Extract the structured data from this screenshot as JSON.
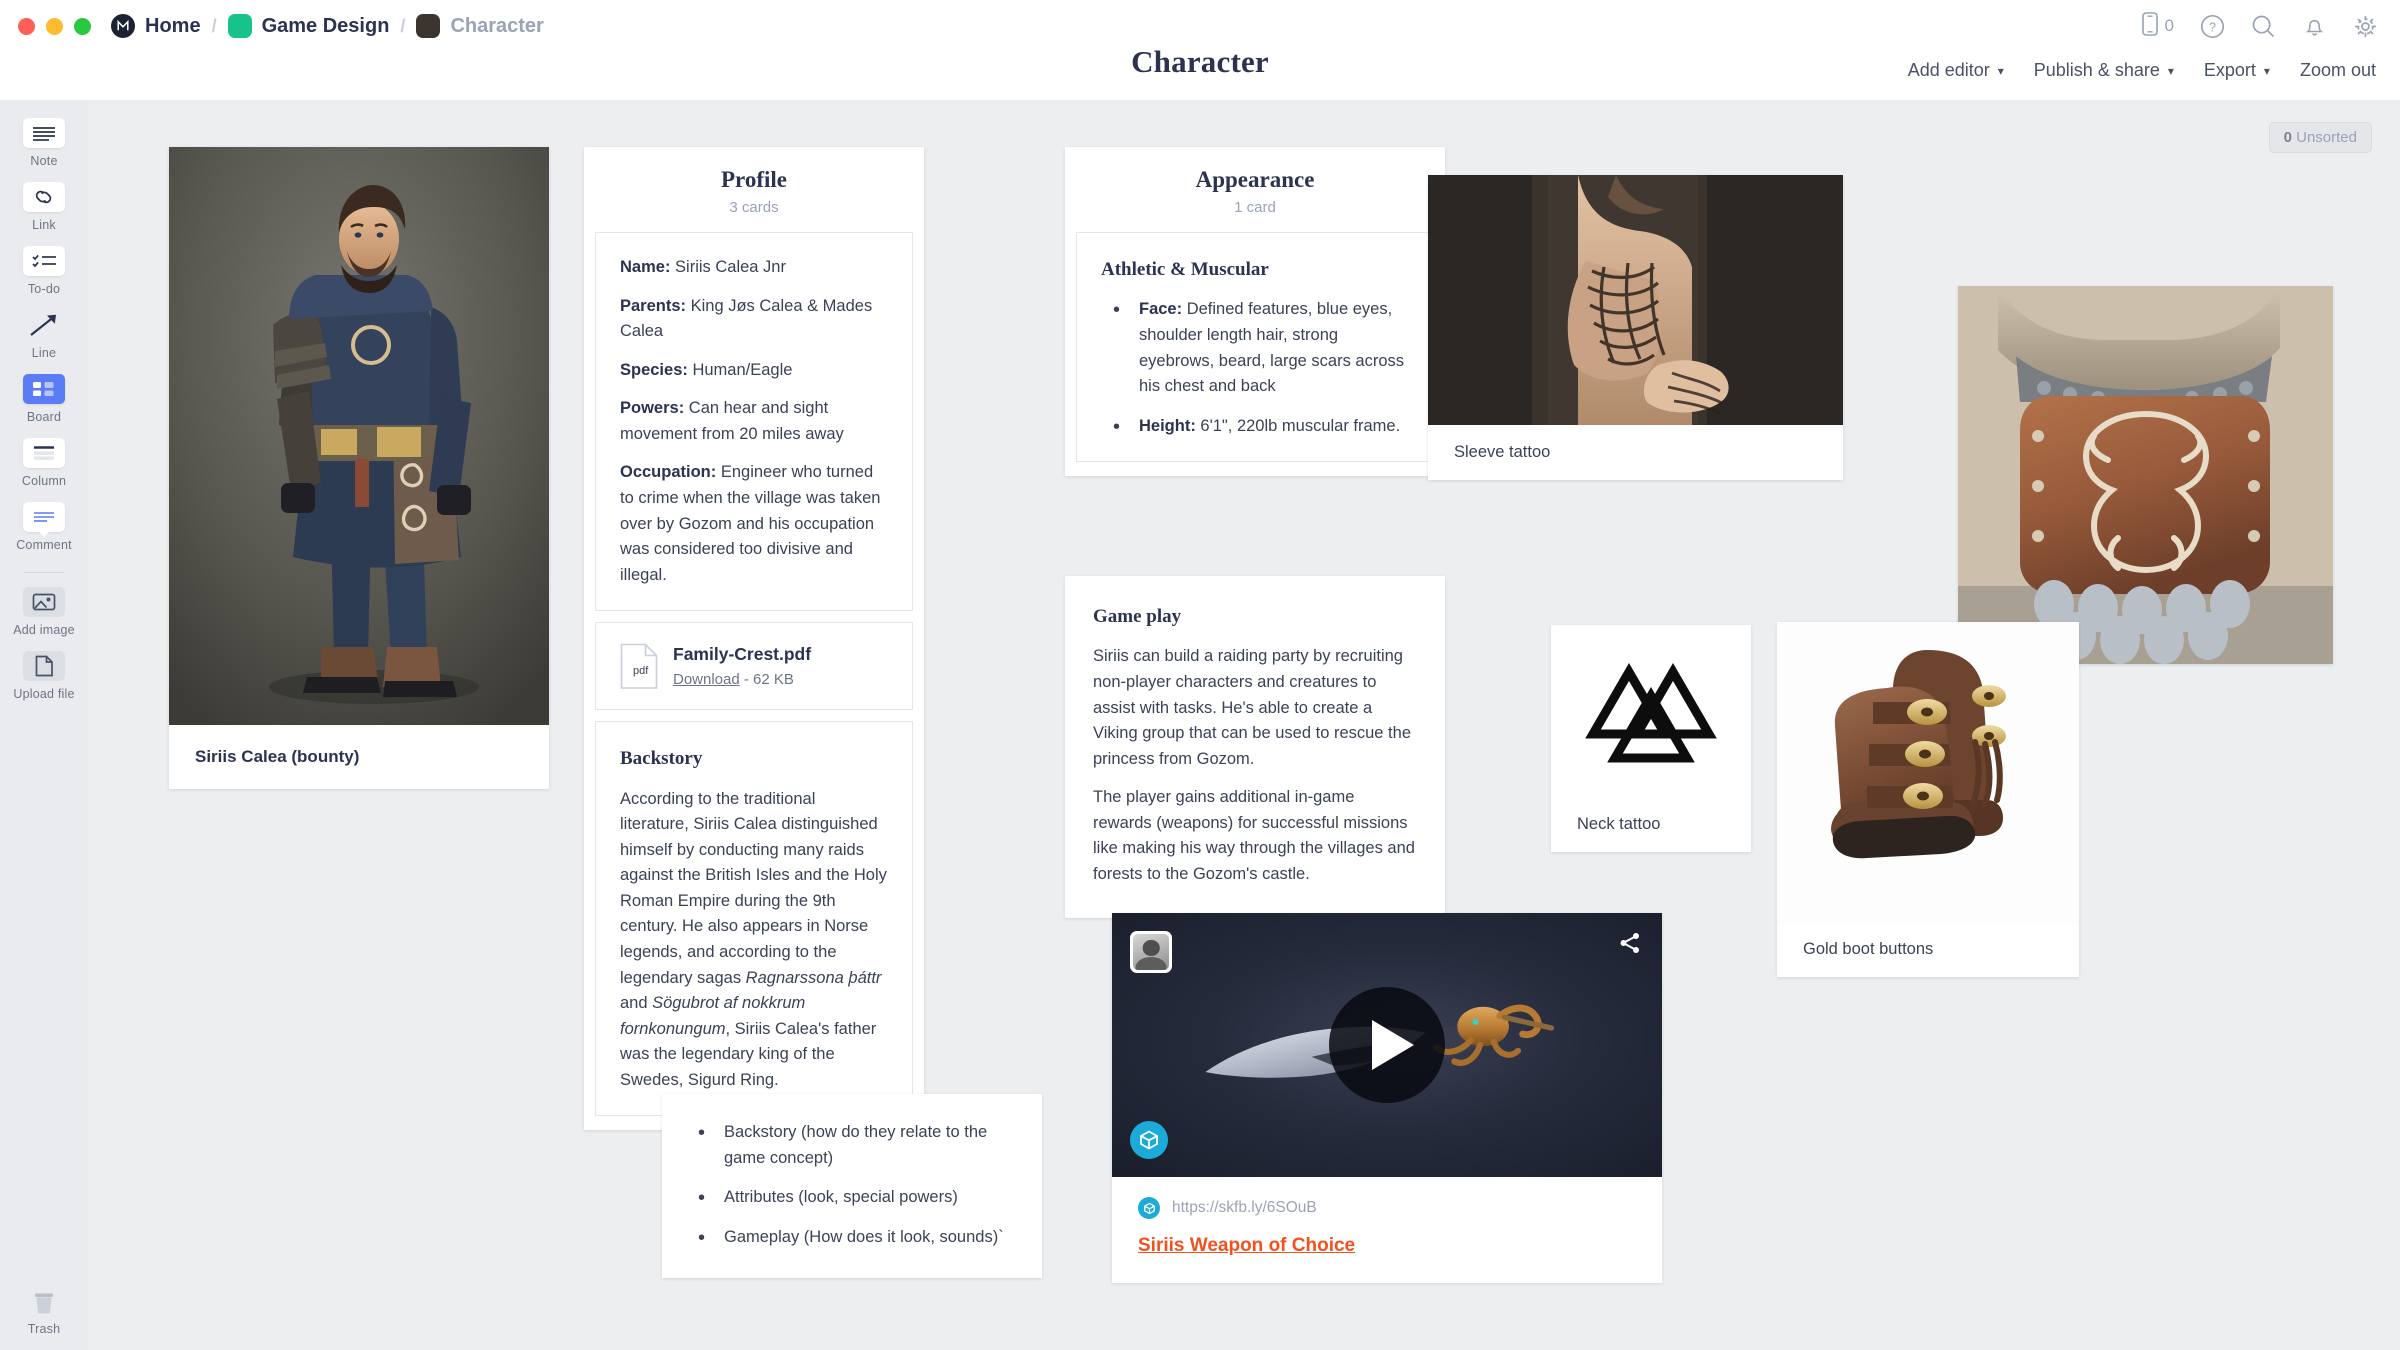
{
  "window": {
    "traffic_lights": [
      "close",
      "minimize",
      "zoom"
    ],
    "breadcrumbs": [
      {
        "label": "Home",
        "icon": "milanote-logo-icon",
        "color": "#1d2233"
      },
      {
        "label": "Game Design",
        "icon": "board-swatch-icon",
        "color": "#17c38a"
      },
      {
        "label": "Character",
        "icon": "board-swatch-icon",
        "color": "#3c352f"
      }
    ],
    "device_count": "0",
    "icons": [
      "mobile-preview-icon",
      "help-icon",
      "search-icon",
      "notifications-icon",
      "settings-gear-icon"
    ]
  },
  "header": {
    "title": "Character",
    "actions": [
      {
        "label": "Add editor",
        "has_caret": true
      },
      {
        "label": "Publish & share",
        "has_caret": true
      },
      {
        "label": "Export",
        "has_caret": true
      },
      {
        "label": "Zoom out",
        "has_caret": false
      }
    ]
  },
  "toolbar": {
    "items": [
      {
        "label": "Note",
        "icon": "note-icon",
        "active": false
      },
      {
        "label": "Link",
        "icon": "link-icon",
        "active": false
      },
      {
        "label": "To-do",
        "icon": "todo-icon",
        "active": false
      },
      {
        "label": "Line",
        "icon": "line-arrow-icon",
        "active": false
      },
      {
        "label": "Board",
        "icon": "board-icon",
        "active": true
      },
      {
        "label": "Column",
        "icon": "column-icon",
        "active": false
      },
      {
        "label": "Comment",
        "icon": "comment-icon",
        "active": false
      },
      {
        "label": "Add image",
        "icon": "image-icon",
        "active": false
      },
      {
        "label": "Upload file",
        "icon": "file-icon",
        "active": false
      }
    ],
    "trash": {
      "label": "Trash",
      "icon": "trash-icon"
    },
    "accent_color": "#5b7cf5"
  },
  "canvas": {
    "unsorted_badge": {
      "count": "0",
      "label": "Unsorted"
    },
    "hero": {
      "caption": "Siriis Calea (bounty)",
      "image_alt": "character-concept-art"
    },
    "profile_column": {
      "title": "Profile",
      "card_count": "3 cards",
      "details": [
        {
          "label": "Name:",
          "value": " Siriis Calea Jnr"
        },
        {
          "label": "Parents:",
          "value": " King Jøs Calea & Mades Calea"
        },
        {
          "label": "Species:",
          "value": " Human/Eagle"
        },
        {
          "label": "Powers:",
          "value": " Can hear and sight movement from 20 miles away"
        },
        {
          "label": "Occupation:",
          "value": " Engineer who turned to crime when the village was taken over by Gozom and his occupation was considered too divisive and illegal."
        }
      ],
      "file": {
        "name": "Family-Crest.pdf",
        "type_label": "pdf",
        "download_label": "Download",
        "size": "- 62 KB"
      },
      "backstory": {
        "heading": "Backstory",
        "text_1": "According to the traditional literature, Siriis Calea distinguished himself by conducting many raids against the British Isles and the Holy Roman Empire during the 9th century. He also appears in Norse legends, and according to the legendary sagas ",
        "italic_1": "Ragnarssona þáttr",
        "text_2": " and ",
        "italic_2": "Sögubrot af nokkrum fornkonungum",
        "text_3": ", Siriis Calea's father was the legendary king of the Swedes, Sigurd Ring."
      }
    },
    "appearance_column": {
      "title": "Appearance",
      "card_count": "1 card",
      "card_heading": "Athletic & Muscular",
      "bullets": [
        {
          "label": "Face:",
          "value": " Defined features, blue eyes, shoulder length hair, strong eyebrows, beard, large scars across his chest and back"
        },
        {
          "label": "Height:",
          "value": " 6'1\", 220lb muscular frame."
        }
      ]
    },
    "gameplay_card": {
      "heading": "Game play",
      "paragraph_1": "Siriis can build a raiding party by recruiting non-player characters and creatures to assist with tasks. He's able to create a Viking group that can be used to rescue the princess from Gozom.",
      "paragraph_2": "The player gains additional in-game rewards (weapons) for successful missions like making his way through the villages and forests to the Gozom's castle."
    },
    "checklist_card": {
      "items": [
        "Backstory (how do they relate to the game concept)",
        "Attributes (look, special powers)",
        "Gameplay (How does it look, sounds)`"
      ]
    },
    "video_card": {
      "url": "https://skfb.ly/6SOuB",
      "title": "Siriis Weapon of Choice",
      "source_icon": "sketchfab-icon",
      "share_icon": "share-icon",
      "play_icon": "play-icon",
      "link_color": "#f4511e"
    },
    "image_cards": [
      {
        "caption": "Sleeve tattoo",
        "name": "sleeve-tattoo-image"
      },
      {
        "caption": "Neck tattoo",
        "name": "neck-tattoo-image"
      },
      {
        "caption": "Gold boot buttons",
        "name": "gold-boot-buttons-image"
      }
    ],
    "armor_card": {
      "caption": "",
      "name": "armor-image"
    }
  }
}
